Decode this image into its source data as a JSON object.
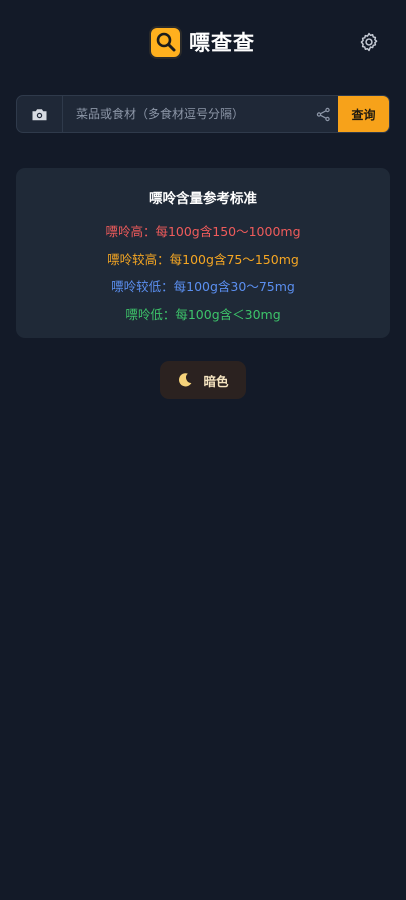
{
  "app": {
    "title": "嘌查查",
    "logo_icon": "magnifier-icon",
    "settings_icon": "gear-icon"
  },
  "search": {
    "camera_icon": "camera-icon",
    "placeholder": "菜品或食材（多食材逗号分隔）",
    "value": "",
    "share_icon": "share-icon",
    "query_label": "查询"
  },
  "reference": {
    "title": "嘌呤含量参考标准",
    "levels": [
      {
        "label": "嘌呤高：每100g含150～1000mg",
        "color": "#ef5b5b"
      },
      {
        "label": "嘌呤较高：每100g含75～150mg",
        "color": "#f5a623"
      },
      {
        "label": "嘌呤较低：每100g含30～75mg",
        "color": "#5b8ff0"
      },
      {
        "label": "嘌呤低：每100g含＜30mg",
        "color": "#3dc46a"
      }
    ]
  },
  "theme_toggle": {
    "icon": "moon-icon",
    "label": "暗色"
  },
  "colors": {
    "background": "#131a28",
    "card": "#1f2937",
    "accent": "#f7a21a"
  }
}
